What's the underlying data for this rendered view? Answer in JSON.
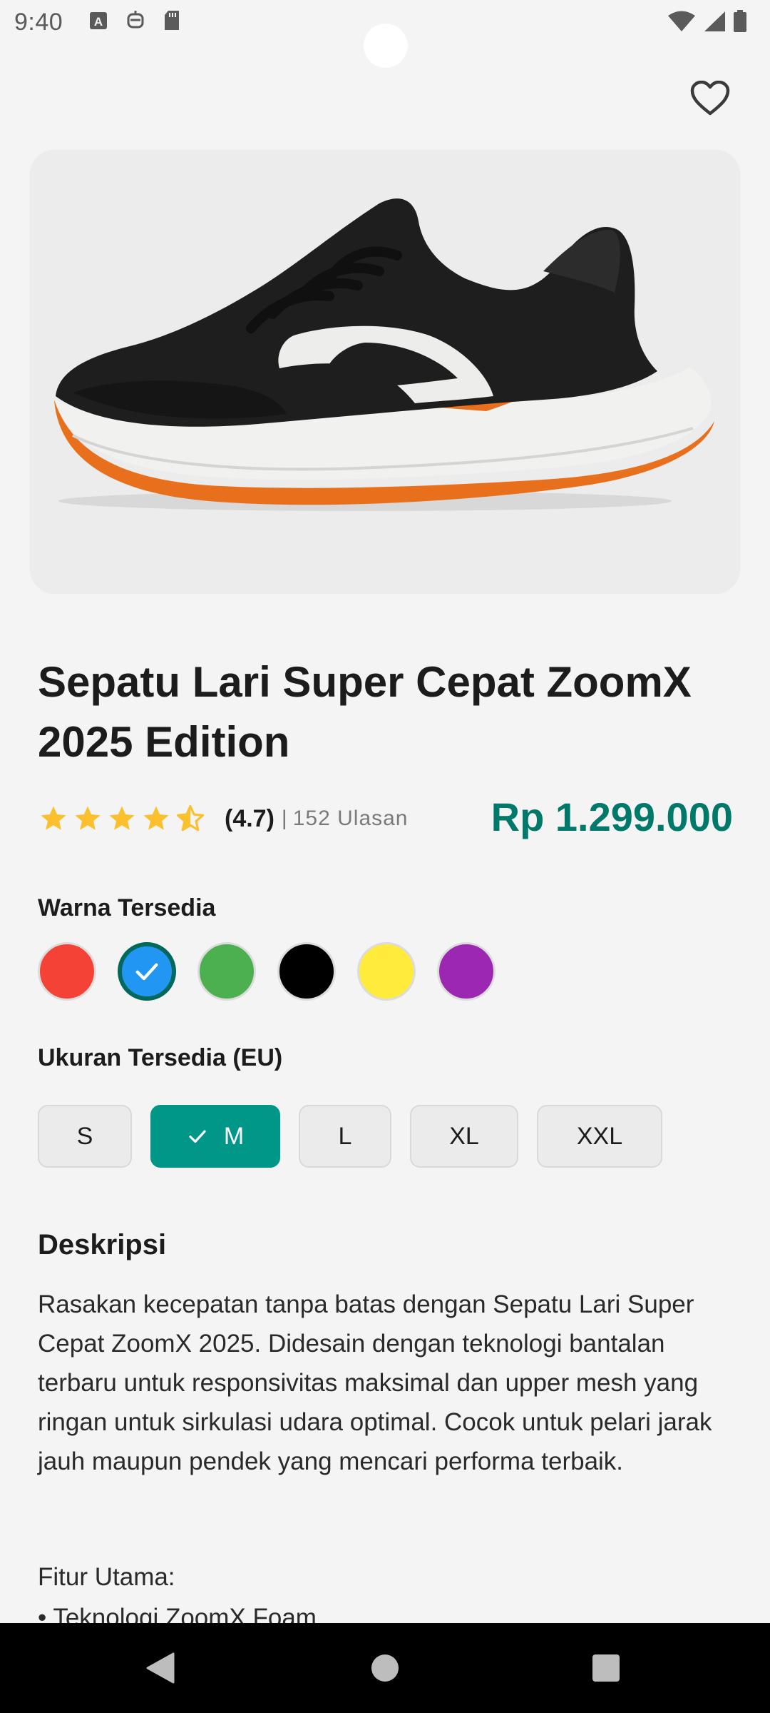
{
  "status_bar": {
    "time": "9:40"
  },
  "product": {
    "title": "Sepatu Lari Super Cepat ZoomX 2025 Edition",
    "rating": 4.7,
    "rating_text": "(4.7)",
    "separator": "|",
    "review_count": "152 Ulasan",
    "price": "Rp 1.299.000"
  },
  "colors": {
    "label": "Warna Tersedia",
    "options": [
      {
        "name": "red",
        "hex": "#f44336"
      },
      {
        "name": "blue",
        "hex": "#2196f3",
        "selected": true
      },
      {
        "name": "green",
        "hex": "#4caf50"
      },
      {
        "name": "black",
        "hex": "#000000"
      },
      {
        "name": "yellow",
        "hex": "#ffeb3b"
      },
      {
        "name": "purple",
        "hex": "#9c27b0"
      }
    ]
  },
  "sizes": {
    "label": "Ukuran Tersedia (EU)",
    "options": [
      {
        "label": "S"
      },
      {
        "label": "M",
        "selected": true
      },
      {
        "label": "L"
      },
      {
        "label": "XL"
      },
      {
        "label": "XXL"
      }
    ]
  },
  "description": {
    "title": "Deskripsi",
    "body": "Rasakan kecepatan tanpa batas dengan Sepatu Lari Super Cepat ZoomX 2025. Didesain dengan teknologi bantalan terbaru untuk responsivitas maksimal dan upper mesh yang ringan untuk sirkulasi udara optimal. Cocok untuk pelari jarak jauh maupun pendek yang mencari performa terbaik.",
    "features_title": "Fitur Utama:",
    "features": [
      "• Teknologi ZoomX Foam"
    ]
  },
  "theme": {
    "accent": "#009688",
    "price_color": "#00796b",
    "star_color": "#fbc02d"
  },
  "icons": {
    "favorite": "heart-outline-icon",
    "back": "back-triangle-icon",
    "home": "home-circle-icon",
    "recents": "recents-square-icon"
  }
}
